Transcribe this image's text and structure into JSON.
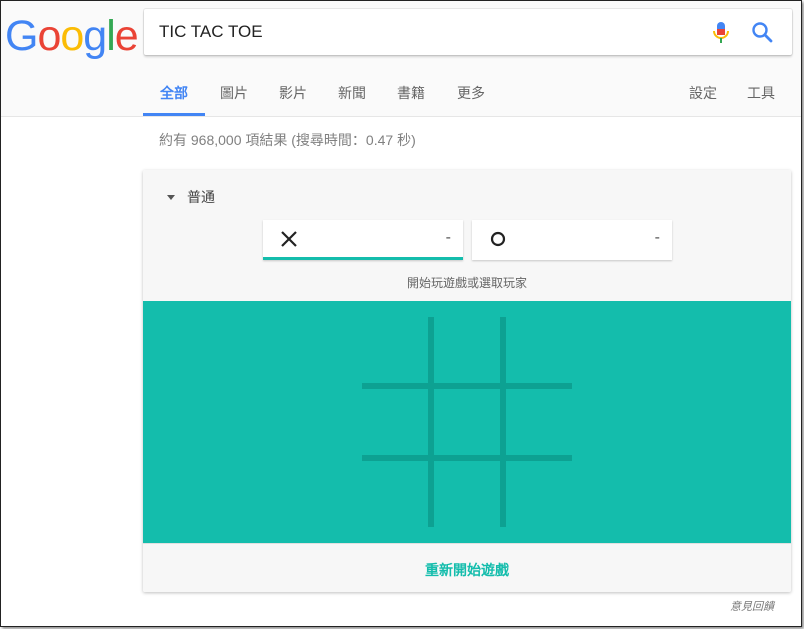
{
  "logo": {
    "letters": [
      {
        "ch": "G",
        "color": "#4285F4"
      },
      {
        "ch": "o",
        "color": "#EA4335"
      },
      {
        "ch": "o",
        "color": "#FBBC05"
      },
      {
        "ch": "g",
        "color": "#4285F4"
      },
      {
        "ch": "l",
        "color": "#34A853"
      },
      {
        "ch": "e",
        "color": "#EA4335"
      }
    ]
  },
  "search": {
    "query": "TIC TAC TOE",
    "mic_icon": "microphone-icon",
    "search_icon": "magnifier-icon"
  },
  "tabs": {
    "all": "全部",
    "images": "圖片",
    "videos": "影片",
    "news": "新聞",
    "books": "書籍",
    "more": "更多",
    "settings": "設定",
    "tools": "工具"
  },
  "stats": "約有 968,000 項結果 (搜尋時間：0.47 秒)",
  "game": {
    "difficulty": "普通",
    "player_x": {
      "symbol": "X",
      "score": "-"
    },
    "player_o": {
      "symbol": "O",
      "score": "-"
    },
    "hint": "開始玩遊戲或選取玩家",
    "board_color": "#14BDAC",
    "line_color": "#0DA192",
    "restart": "重新開始遊戲"
  },
  "feedback": "意見回饋",
  "colors": {
    "accent": "#4285F4",
    "game": "#14BDAC"
  }
}
